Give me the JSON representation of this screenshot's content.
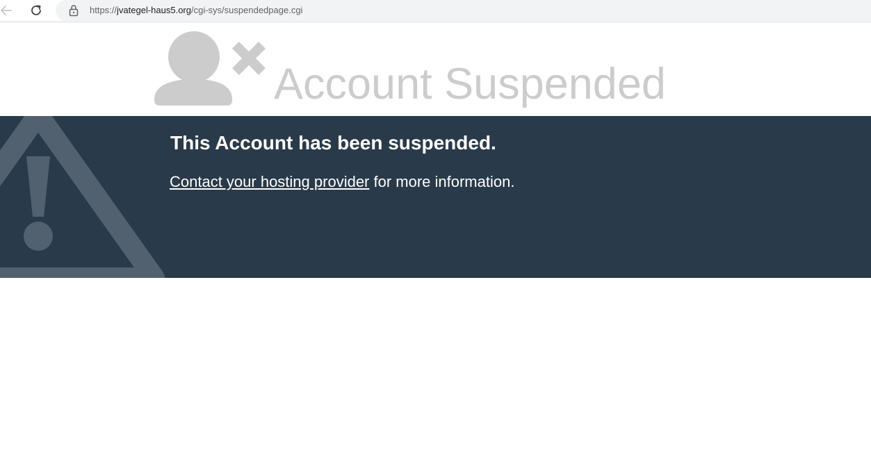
{
  "browser": {
    "url_prefix": "https://",
    "url_host": "jvategel-haus5.org",
    "url_path": "/cgi-sys/suspendedpage.cgi"
  },
  "header": {
    "title": "Account Suspended"
  },
  "banner": {
    "heading": "This Account has been suspended.",
    "link_text": "Contact your hosting provider",
    "info_suffix": " for more information."
  },
  "colors": {
    "banner_background": "#293a4a",
    "title_gray": "#cccccc",
    "warning_icon": "#526170"
  },
  "icons": {
    "back": "arrow-left-icon",
    "reload": "reload-icon",
    "lock": "lock-icon",
    "user": "user-x-icon",
    "warning": "warning-triangle-icon"
  }
}
